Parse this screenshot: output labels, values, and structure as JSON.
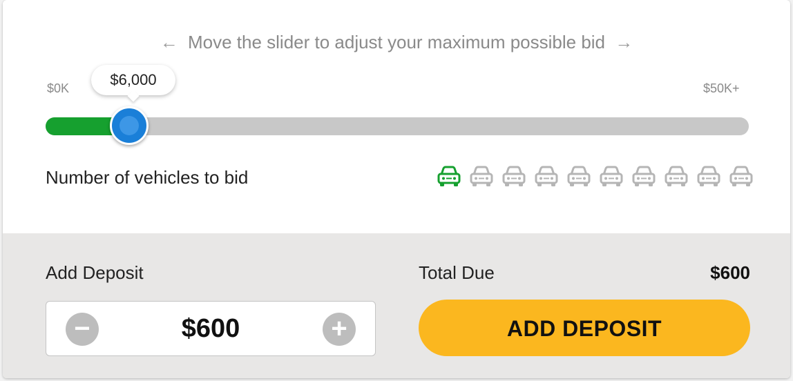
{
  "slider": {
    "hint": "Move the slider to adjust your maximum possible bid",
    "left_arrow": "←",
    "right_arrow": "→",
    "min_label": "$0K",
    "max_label": "$50K+",
    "value_label": "$6,000",
    "value": 6000,
    "min": 0,
    "max": 50000,
    "fill_color": "#16a02f",
    "thumb_color": "#1a7fd8"
  },
  "vehicles": {
    "label": "Number of vehicles to bid",
    "count_active": 1,
    "count_total": 10,
    "active_color": "#16a02f",
    "inactive_color": "#b5b5b5",
    "icon": "car-icon"
  },
  "deposit": {
    "label": "Add Deposit",
    "value": "$600",
    "minus_icon": "minus-icon",
    "plus_icon": "plus-icon"
  },
  "total": {
    "label": "Total Due",
    "value": "$600"
  },
  "add_button": {
    "label": "ADD DEPOSIT",
    "color": "#fbb71f"
  }
}
